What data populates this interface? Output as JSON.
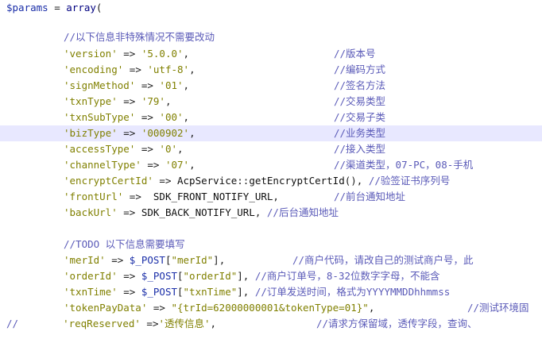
{
  "code": {
    "line1": {
      "var": "$params",
      "eq": " = ",
      "kw": "array",
      "paren": "("
    },
    "comment_defaults": "//以下信息非特殊情况不需要改动",
    "version": {
      "key": "'version'",
      "arrow": " => ",
      "val": "'5.0.0'",
      "comma": ",",
      "comment": "//版本号"
    },
    "encoding": {
      "key": "'encoding'",
      "arrow": " => ",
      "val": "'utf-8'",
      "comma": ",",
      "comment": "//编码方式"
    },
    "signMethod": {
      "key": "'signMethod'",
      "arrow": " => ",
      "val": "'01'",
      "comma": ",",
      "comment": "//签名方法"
    },
    "txnType": {
      "key": "'txnType'",
      "arrow": " => ",
      "val": "'79'",
      "comma": ",",
      "comment": "//交易类型"
    },
    "txnSubType": {
      "key": "'txnSubType'",
      "arrow": " => ",
      "val": "'00'",
      "comma": ",",
      "comment": "//交易子类"
    },
    "bizType": {
      "key": "'bizType'",
      "arrow": " => ",
      "val": "'000902'",
      "comma": ",",
      "comment": "//业务类型"
    },
    "accessType": {
      "key": "'accessType'",
      "arrow": " => ",
      "val": "'0'",
      "comma": ",",
      "comment": "//接入类型"
    },
    "channelType": {
      "key": "'channelType'",
      "arrow": " => ",
      "val": "'07'",
      "comma": ",",
      "comment": "//渠道类型，07-PC，08-手机"
    },
    "encryptCertId": {
      "key": "'encryptCertId'",
      "arrow": " => ",
      "cls": "AcpService",
      "sep": "::",
      "fn": "getEncryptCertId",
      "call": "(),",
      "comment": " //验签证书序列号"
    },
    "frontUrl": {
      "key": "'frontUrl'",
      "arrow": " =>  ",
      "const": "SDK_FRONT_NOTIFY_URL",
      "comma": ",",
      "comment": "//前台通知地址"
    },
    "backUrl": {
      "key": "'backUrl'",
      "arrow": " => ",
      "const": "SDK_BACK_NOTIFY_URL",
      "comma": ",",
      "comment": " //后台通知地址"
    },
    "comment_todo": "//TODO 以下信息需要填写",
    "merId": {
      "key": "'merId'",
      "arrow": " => ",
      "post": "$_POST",
      "lb": "[",
      "idx": "\"merId\"",
      "rb": "],",
      "comment": "//商户代码，请改自己的测试商户号，此"
    },
    "orderId": {
      "key": "'orderId'",
      "arrow": " => ",
      "post": "$_POST",
      "lb": "[",
      "idx": "\"orderId\"",
      "rb": "],",
      "comment": " //商户订单号，8-32位数字字母，不能含"
    },
    "txnTime": {
      "key": "'txnTime'",
      "arrow": " => ",
      "post": "$_POST",
      "lb": "[",
      "idx": "\"txnTime\"",
      "rb": "],",
      "comment": " //订单发送时间，格式为YYYYMMDDhhmmss"
    },
    "tokenPayData": {
      "key": "'tokenPayData'",
      "arrow": " => ",
      "val": "\"{trId=62000000001&tokenType=01}\"",
      "comma": ",",
      "comment": "//测试环境固"
    },
    "reqReserved": {
      "lead": "//",
      "key": "'reqReserved'",
      "arrow": " =>",
      "val": "'透传信息'",
      "comma": ",",
      "comment": "//请求方保留域，透传字段，查询、"
    }
  },
  "colors": {
    "variable": "#1a2ea8",
    "string": "#808000",
    "comment": "#5a5ab8",
    "highlight_line": "#e8e8ff",
    "background": "#ffffff"
  }
}
